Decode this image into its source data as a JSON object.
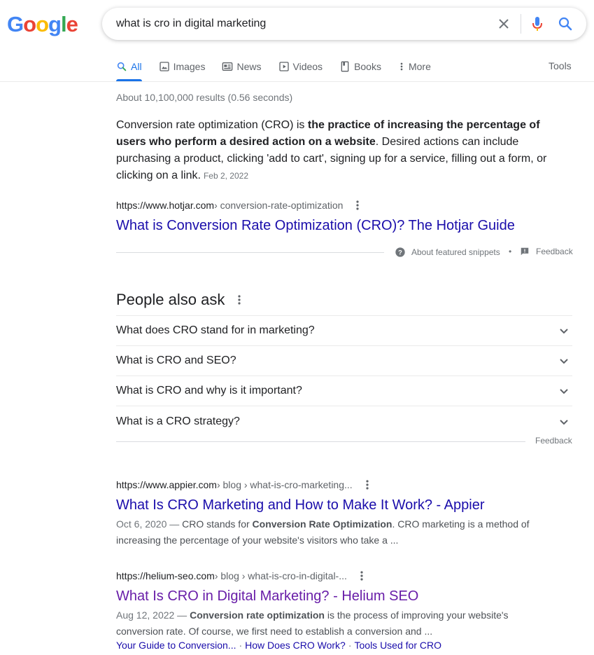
{
  "logo": {
    "text": "Google",
    "colors": [
      "#4285F4",
      "#EA4335",
      "#FBBC05",
      "#4285F4",
      "#34A853",
      "#EA4335"
    ]
  },
  "search": {
    "query": "what is cro in digital marketing"
  },
  "tabs": [
    {
      "label": "All",
      "icon": "search-icon",
      "active": true
    },
    {
      "label": "Images",
      "icon": "image-icon"
    },
    {
      "label": "News",
      "icon": "news-icon"
    },
    {
      "label": "Videos",
      "icon": "play-icon"
    },
    {
      "label": "Books",
      "icon": "book-icon"
    },
    {
      "label": "More",
      "icon": "more-vert-icon"
    }
  ],
  "tools_label": "Tools",
  "result_stats": "About 10,100,000 results (0.56 seconds)",
  "featured_snippet": {
    "text_before": "Conversion rate optimization (CRO) is ",
    "bold": "the practice of increasing the percentage of users who perform a desired action on a website",
    "text_after": ". Desired actions can include purchasing a product, clicking 'add to cart', signing up for a service, filling out a form, or clicking on a link.",
    "date": "Feb 2, 2022",
    "cite_host": "https://www.hotjar.com",
    "cite_path": " › conversion-rate-optimization",
    "title": "What is Conversion Rate Optimization (CRO)? The Hotjar Guide",
    "about_label": "About featured snippets",
    "dot": "•",
    "feedback_label": "Feedback"
  },
  "people_also_ask": {
    "title": "People also ask",
    "questions": [
      "What does CRO stand for in marketing?",
      "What is CRO and SEO?",
      "What is CRO and why is it important?",
      "What is a CRO strategy?"
    ],
    "feedback_label": "Feedback"
  },
  "results": [
    {
      "cite_host": "https://www.appier.com",
      "cite_path": " › blog › what-is-cro-marketing...",
      "title": "What Is CRO Marketing and How to Make It Work? - Appier",
      "date": "Oct 6, 2020",
      "dash": " — ",
      "snippet_before": "CRO stands for ",
      "snippet_bold": "Conversion Rate Optimization",
      "snippet_after": ". CRO marketing is a method of increasing the percentage of your website's visitors who take a ..."
    },
    {
      "cite_host": "https://helium-seo.com",
      "cite_path": " › blog › what-is-cro-in-digital-...",
      "title": "What Is CRO in Digital Marketing? - Helium SEO",
      "date": "Aug 12, 2022",
      "dash": " — ",
      "snippet_bold": "Conversion rate optimization",
      "snippet_after": " is the process of improving your website's conversion rate. Of course, we first need to establish a conversion and ...",
      "sitelinks": [
        "Your Guide to Conversion...",
        "How Does CRO Work?",
        "Tools Used for CRO"
      ],
      "sitelink_sep": "·"
    }
  ]
}
